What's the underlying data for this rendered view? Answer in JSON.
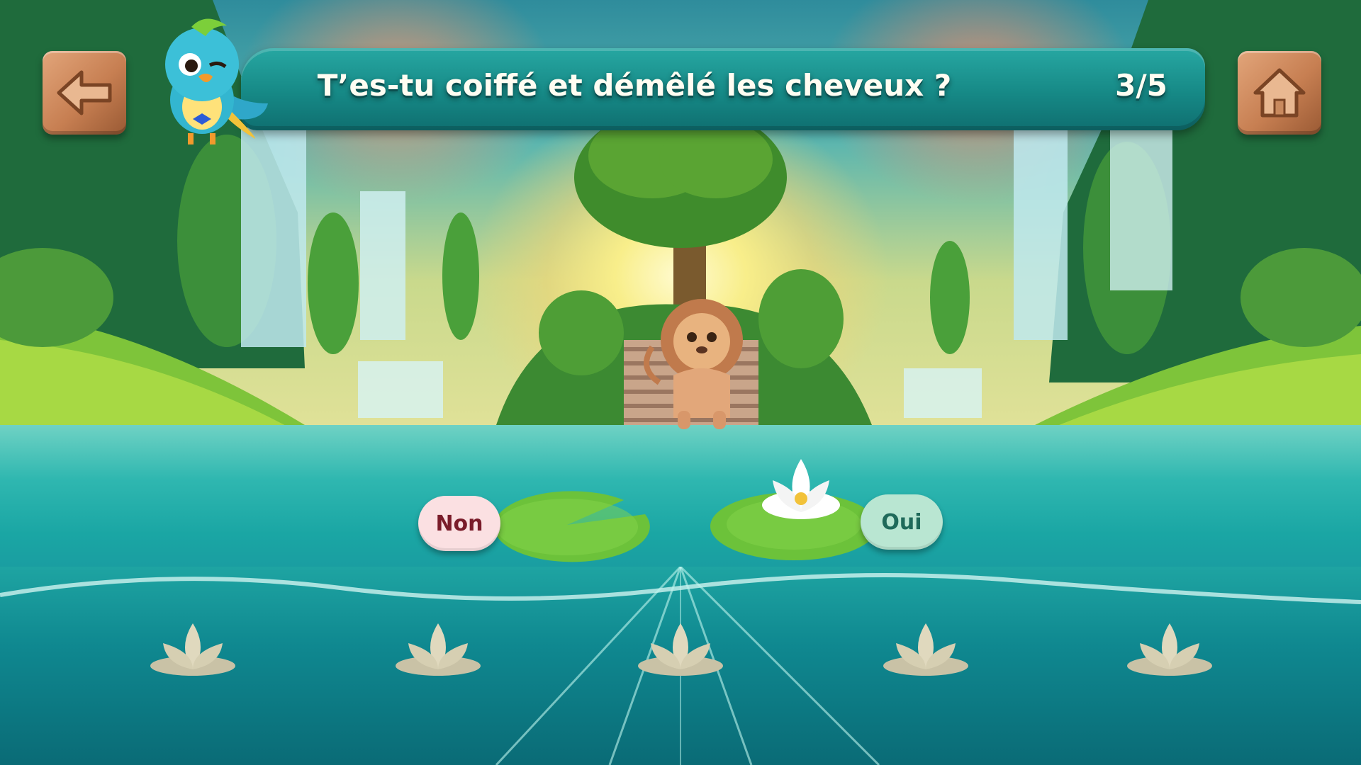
{
  "header": {
    "question": "T’es-tu coiffé et démêlé les cheveux ?",
    "progress": "3/5"
  },
  "navigation": {
    "back_icon": "arrow-left-icon",
    "home_icon": "home-icon"
  },
  "answers": {
    "no_label": "Non",
    "yes_label": "Oui"
  },
  "progress_lotuses": {
    "total": 5,
    "icon": "lotus-icon"
  },
  "colors": {
    "banner": "#168986",
    "wood": "#c77f52",
    "no_button": "#fbe0e2",
    "yes_button": "#b9e6d2"
  }
}
